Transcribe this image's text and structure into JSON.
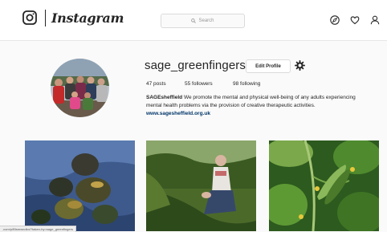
{
  "header": {
    "logo_icon": "instagram-camera-icon",
    "wordmark": "Instagram",
    "search_placeholder": "Search",
    "icons": [
      "compass-icon",
      "heart-icon",
      "person-icon"
    ]
  },
  "profile": {
    "username": "sage_greenfingers",
    "edit_button": "Edit Profile",
    "settings_icon": "gear-icon",
    "stats": {
      "posts": "47 posts",
      "followers": "55 followers",
      "following": "98 following"
    },
    "bio": {
      "name": "SAGEsheffield",
      "text": " We promote the mental and physical well-being of any adults experiencing mental health problems via the provision of creative therapeutic activities. ",
      "link": "www.sagesheffield.org.uk"
    }
  },
  "posts": [
    {
      "subject": "squash-harvest-photo"
    },
    {
      "subject": "person-kneeling-in-garden-photo"
    },
    {
      "subject": "cucumber-plant-photo"
    }
  ],
  "status_url": ".com/p/BIsmwndkn/?taken-by=sage_greenfingers"
}
